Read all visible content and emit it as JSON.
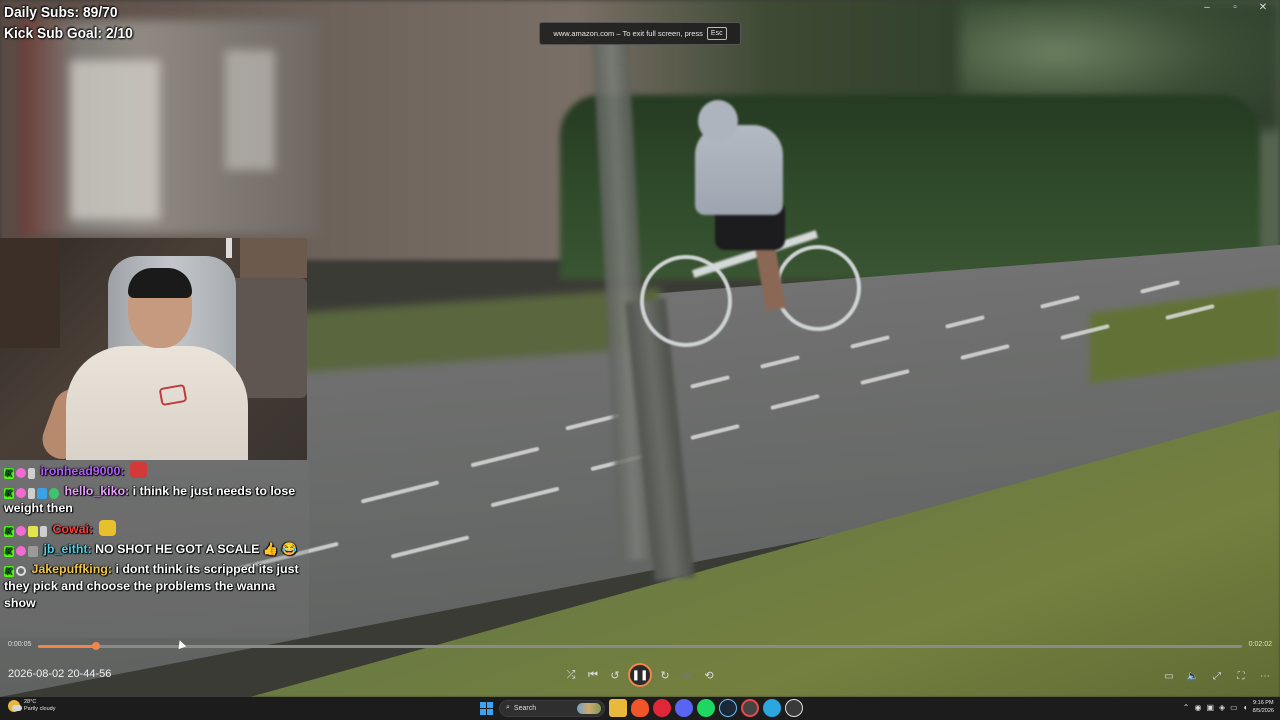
{
  "window": {
    "minimize_glyph": "–",
    "maximize_glyph": "▫",
    "close_glyph": "✕"
  },
  "overlay": {
    "daily_subs": "Daily Subs: 89/70",
    "kick_goal": "Kick Sub Goal: 2/10"
  },
  "fullscreen_notice": {
    "text": "www.amazon.com – To exit full screen, press",
    "key": "Esc"
  },
  "chat": {
    "messages": [
      {
        "user": "ironhead9000:",
        "user_color": "#b35cff",
        "text": "",
        "emote_color": "#d23a3a"
      },
      {
        "user": "hello_kiko:",
        "user_color": "#e9a2ff",
        "text": "i think he just needs to lose weight then"
      },
      {
        "user": "Cowai:",
        "user_color": "#ff3b3b",
        "text": "",
        "emote_color": "#e8c02c"
      },
      {
        "user": "jb_eitht:",
        "user_color": "#4fd1e6",
        "text": "NO SHOT HE GOT A SCALE",
        "emote_color": "#f2c23a"
      },
      {
        "user": "Jakepuffking:",
        "user_color": "#f2c74a",
        "text": "i dont think its scripped its just they pick and choose the problems the wanna show"
      }
    ],
    "emoji_1": "👍",
    "emoji_2": "😂"
  },
  "player": {
    "current_time": "0:00:05",
    "total_time": "0:02:02",
    "progress": 0.048,
    "file_title": "2026-08-02 20-44-56",
    "accent_color": "#f0864a",
    "controls": {
      "shuffle": "⤮",
      "previous": "⏮",
      "rewind": "↺",
      "pause": "❚❚",
      "forward": "↻",
      "next": "⏭",
      "repeat": "⟲"
    },
    "right_controls": {
      "mini": "▭",
      "volume": "🔈",
      "fullscreen": "⤢",
      "expand": "⛶",
      "more": "⋯"
    }
  },
  "taskbar": {
    "weather_temp": "28°C",
    "weather_desc": "Partly cloudy",
    "search_label": "Search",
    "time": "9:16 PM",
    "date": "8/5/2026",
    "tray_chevron": "⌃"
  }
}
